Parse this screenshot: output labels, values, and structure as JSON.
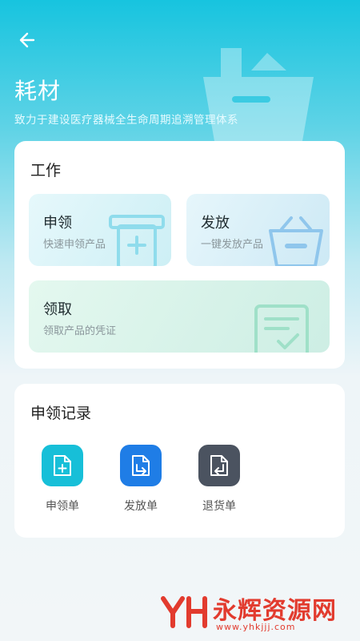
{
  "header": {
    "title": "耗材",
    "subtitle": "致力于建设医疗器械全生命周期追溯管理体系"
  },
  "work": {
    "title": "工作",
    "tiles": [
      {
        "title": "申领",
        "subtitle": "快速申领产品"
      },
      {
        "title": "发放",
        "subtitle": "一键发放产品"
      },
      {
        "title": "领取",
        "subtitle": "领取产品的凭证"
      }
    ]
  },
  "records": {
    "title": "申领记录",
    "items": [
      {
        "label": "申领单",
        "color": "#17bfd8",
        "icon": "file-add-icon"
      },
      {
        "label": "发放单",
        "color": "#1f7de6",
        "icon": "file-export-icon"
      },
      {
        "label": "退货单",
        "color": "#4b5360",
        "icon": "file-return-icon"
      }
    ]
  },
  "watermark": {
    "text": "永辉资源网",
    "url": "www.yhkjjj.com"
  },
  "colors": {
    "accent": "#17c4df",
    "background": "#f2f6f8"
  }
}
